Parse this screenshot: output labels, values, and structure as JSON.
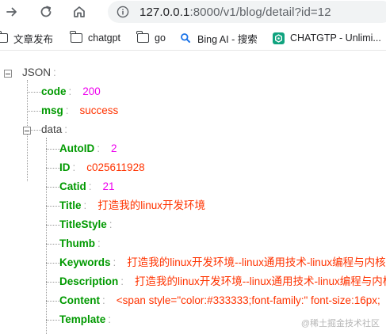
{
  "browser": {
    "url_host": "127.0.0.1",
    "url_rest": ":8000/v1/blog/detail?id=12"
  },
  "bookmarks": [
    {
      "label": "文章发布",
      "icon": "folder-icon"
    },
    {
      "label": "chatgpt",
      "icon": "folder-icon"
    },
    {
      "label": "go",
      "icon": "folder-icon"
    },
    {
      "label": "Bing AI - 搜索",
      "icon": "bing-search-icon"
    },
    {
      "label": "CHATGTP - Unlimi...",
      "icon": "chatgpt-logo-icon"
    }
  ],
  "json": {
    "root_label": "JSON",
    "code": {
      "key": "code",
      "value": "200"
    },
    "msg": {
      "key": "msg",
      "value": "success"
    },
    "data": {
      "key": "data",
      "fields": [
        {
          "key": "AutoID",
          "value": "2",
          "type": "number"
        },
        {
          "key": "ID",
          "value": "c025611928",
          "type": "string"
        },
        {
          "key": "Catid",
          "value": "21",
          "type": "number"
        },
        {
          "key": "Title",
          "value": "打造我的linux开发环境",
          "type": "string"
        },
        {
          "key": "TitleStyle",
          "value": "",
          "type": "string"
        },
        {
          "key": "Thumb",
          "value": "",
          "type": "string"
        },
        {
          "key": "Keywords",
          "value": "打造我的linux开发环境--linux通用技术-linux编程与内核",
          "type": "string"
        },
        {
          "key": "Description",
          "value": "打造我的linux开发环境--linux通用技术-linux编程与内核",
          "type": "string"
        },
        {
          "key": "Content",
          "value": "<span style=\"color:#333333;font-family:\" font-size:16px;",
          "type": "string"
        },
        {
          "key": "Template",
          "value": "",
          "type": "string"
        }
      ]
    }
  },
  "watermark": "@稀土掘金技术社区",
  "colors": {
    "key": "#009900",
    "number": "#ee00ee",
    "string": "#ff3300",
    "colon": "#aaaaaa"
  }
}
